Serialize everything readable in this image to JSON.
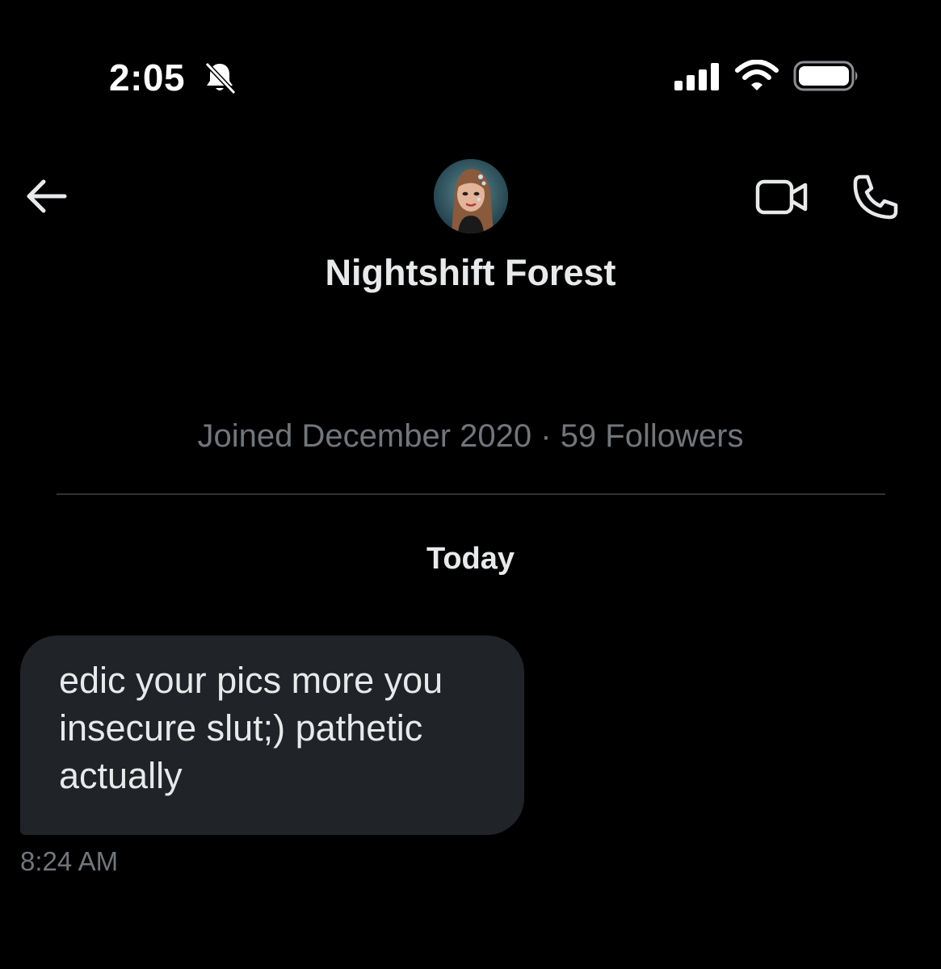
{
  "status_bar": {
    "time": "2:05",
    "icons": [
      "bell-off-icon",
      "cellular-signal-icon",
      "wifi-icon",
      "battery-icon"
    ]
  },
  "header": {
    "back_icon": "arrow-left-icon",
    "avatar": "profile-avatar",
    "video_icon": "video-camera-icon",
    "phone_icon": "phone-icon",
    "name": "Nightshift Forest"
  },
  "profile": {
    "meta": "Joined December 2020 · 59 Followers"
  },
  "conversation": {
    "day_label": "Today",
    "messages": [
      {
        "text": "edic your pics more you\ninsecure slut;) pathetic\nactually",
        "time": "8:24 AM",
        "direction": "incoming"
      }
    ]
  },
  "colors": {
    "background": "#000000",
    "bubble": "#202327",
    "primary_text": "#e7e9ea",
    "secondary_text": "#71767b",
    "divider": "#2f3336"
  }
}
